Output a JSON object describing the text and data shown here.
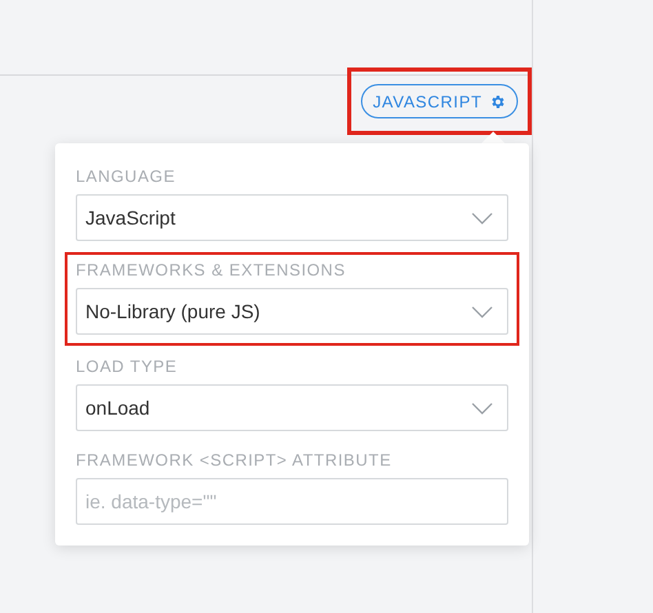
{
  "language_button": {
    "label": "JAVASCRIPT",
    "highlighted": true
  },
  "settings_popover": {
    "fields": [
      {
        "kind": "select",
        "label": "LANGUAGE",
        "value": "JavaScript",
        "highlighted": false
      },
      {
        "kind": "select",
        "label": "FRAMEWORKS & EXTENSIONS",
        "value": "No-Library (pure JS)",
        "highlighted": true
      },
      {
        "kind": "select",
        "label": "LOAD TYPE",
        "value": "onLoad",
        "highlighted": false
      },
      {
        "kind": "text",
        "label": "FRAMEWORK <SCRIPT> ATTRIBUTE",
        "placeholder": "ie. data-type=\"\"",
        "highlighted": false
      }
    ]
  }
}
